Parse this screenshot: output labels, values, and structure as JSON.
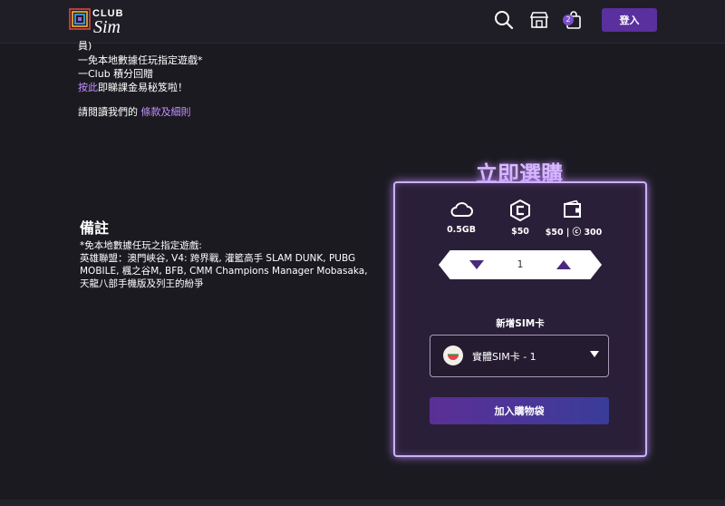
{
  "header": {
    "logo_club": "CLUB",
    "logo_sim": "Sim",
    "cart_count": "2",
    "login_label": "登入",
    "icons": [
      "search-icon",
      "store-icon",
      "cart-icon"
    ]
  },
  "intro": {
    "line0": "員)",
    "line1": "一免本地數據任玩指定遊戲*",
    "line2": "一Club 積分回贈",
    "line3_link": "按此",
    "line3_rest": "即睇課金易秘笈啦！",
    "terms_prefix": "請閱讀我們的",
    "terms_link": "條款及細則"
  },
  "note": {
    "title": "備註",
    "line1": "*免本地數據任玩之指定遊戲:",
    "line2": "英雄聯盟：澳門峽谷, V4: 跨界戰, 灌籃高手 SLAM DUNK, PUBG MOBILE, 楓之谷M, BFB, CMM Champions Manager Mobasaka, 天龍八部手機版及列王的紛爭"
  },
  "buy": {
    "title": "立即選購",
    "features": [
      {
        "icon": "cloud-data-icon",
        "label": "0.5GB"
      },
      {
        "icon": "club-coin-icon",
        "label": "$50"
      },
      {
        "icon": "wallet-icon",
        "label": "$50 | ⓒ 300"
      }
    ],
    "quantity": "1",
    "sim_label": "新增SIM卡",
    "sim_option": "實體SIM卡 - 1",
    "add_to_cart": "加入購物袋"
  },
  "colors": {
    "accent": "#5a2f9e",
    "link": "#c391ff",
    "panel_border": "#cdb0ff"
  }
}
